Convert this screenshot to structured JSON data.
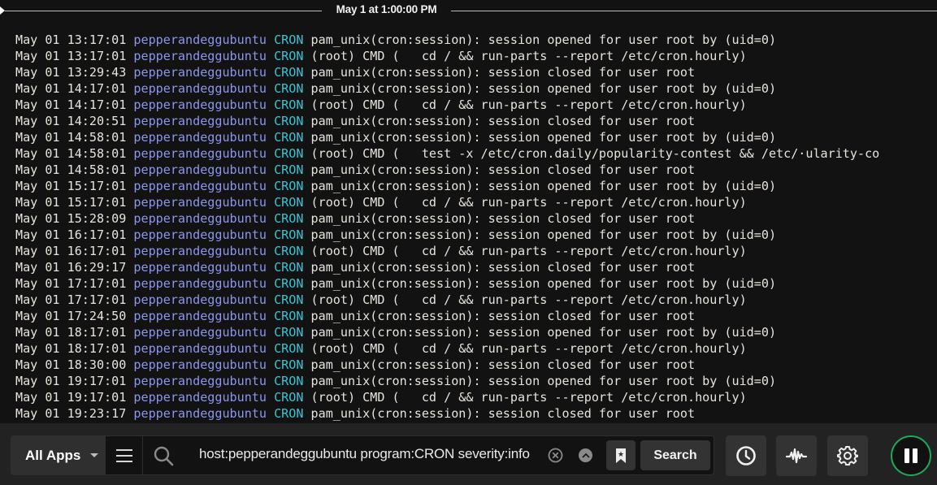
{
  "timeline": {
    "label": "May 1 at 1:00:00 PM"
  },
  "log": [
    {
      "ts": "May 01 13:17:01",
      "host": "pepperandeggubuntu",
      "program": "CRON",
      "message": "pam_unix(cron:session): session opened for user root by (uid=0)"
    },
    {
      "ts": "May 01 13:17:01",
      "host": "pepperandeggubuntu",
      "program": "CRON",
      "message": "(root) CMD (   cd / && run-parts --report /etc/cron.hourly)"
    },
    {
      "ts": "May 01 13:29:43",
      "host": "pepperandeggubuntu",
      "program": "CRON",
      "message": "pam_unix(cron:session): session closed for user root"
    },
    {
      "ts": "May 01 14:17:01",
      "host": "pepperandeggubuntu",
      "program": "CRON",
      "message": "pam_unix(cron:session): session opened for user root by (uid=0)"
    },
    {
      "ts": "May 01 14:17:01",
      "host": "pepperandeggubuntu",
      "program": "CRON",
      "message": "(root) CMD (   cd / && run-parts --report /etc/cron.hourly)"
    },
    {
      "ts": "May 01 14:20:51",
      "host": "pepperandeggubuntu",
      "program": "CRON",
      "message": "pam_unix(cron:session): session closed for user root"
    },
    {
      "ts": "May 01 14:58:01",
      "host": "pepperandeggubuntu",
      "program": "CRON",
      "message": "pam_unix(cron:session): session opened for user root by (uid=0)"
    },
    {
      "ts": "May 01 14:58:01",
      "host": "pepperandeggubuntu",
      "program": "CRON",
      "message": "(root) CMD (   test -x /etc/cron.daily/popularity-contest && /etc/·ularity-co"
    },
    {
      "ts": "May 01 14:58:01",
      "host": "pepperandeggubuntu",
      "program": "CRON",
      "message": "pam_unix(cron:session): session closed for user root"
    },
    {
      "ts": "May 01 15:17:01",
      "host": "pepperandeggubuntu",
      "program": "CRON",
      "message": "pam_unix(cron:session): session opened for user root by (uid=0)"
    },
    {
      "ts": "May 01 15:17:01",
      "host": "pepperandeggubuntu",
      "program": "CRON",
      "message": "(root) CMD (   cd / && run-parts --report /etc/cron.hourly)"
    },
    {
      "ts": "May 01 15:28:09",
      "host": "pepperandeggubuntu",
      "program": "CRON",
      "message": "pam_unix(cron:session): session closed for user root"
    },
    {
      "ts": "May 01 16:17:01",
      "host": "pepperandeggubuntu",
      "program": "CRON",
      "message": "pam_unix(cron:session): session opened for user root by (uid=0)"
    },
    {
      "ts": "May 01 16:17:01",
      "host": "pepperandeggubuntu",
      "program": "CRON",
      "message": "(root) CMD (   cd / && run-parts --report /etc/cron.hourly)"
    },
    {
      "ts": "May 01 16:29:17",
      "host": "pepperandeggubuntu",
      "program": "CRON",
      "message": "pam_unix(cron:session): session closed for user root"
    },
    {
      "ts": "May 01 17:17:01",
      "host": "pepperandeggubuntu",
      "program": "CRON",
      "message": "pam_unix(cron:session): session opened for user root by (uid=0)"
    },
    {
      "ts": "May 01 17:17:01",
      "host": "pepperandeggubuntu",
      "program": "CRON",
      "message": "(root) CMD (   cd / && run-parts --report /etc/cron.hourly)"
    },
    {
      "ts": "May 01 17:24:50",
      "host": "pepperandeggubuntu",
      "program": "CRON",
      "message": "pam_unix(cron:session): session closed for user root"
    },
    {
      "ts": "May 01 18:17:01",
      "host": "pepperandeggubuntu",
      "program": "CRON",
      "message": "pam_unix(cron:session): session opened for user root by (uid=0)"
    },
    {
      "ts": "May 01 18:17:01",
      "host": "pepperandeggubuntu",
      "program": "CRON",
      "message": "(root) CMD (   cd / && run-parts --report /etc/cron.hourly)"
    },
    {
      "ts": "May 01 18:30:00",
      "host": "pepperandeggubuntu",
      "program": "CRON",
      "message": "pam_unix(cron:session): session closed for user root"
    },
    {
      "ts": "May 01 19:17:01",
      "host": "pepperandeggubuntu",
      "program": "CRON",
      "message": "pam_unix(cron:session): session opened for user root by (uid=0)"
    },
    {
      "ts": "May 01 19:17:01",
      "host": "pepperandeggubuntu",
      "program": "CRON",
      "message": "(root) CMD (   cd / && run-parts --report /etc/cron.hourly)"
    },
    {
      "ts": "May 01 19:23:17",
      "host": "pepperandeggubuntu",
      "program": "CRON",
      "message": "pam_unix(cron:session): session closed for user root"
    }
  ],
  "toolbar": {
    "apps_label": "All Apps",
    "query": "host:pepperandeggubuntu program:CRON severity:info",
    "search_label": "Search",
    "icons": {
      "menu": "hamburger-menu-icon",
      "search": "search-icon",
      "clear": "clear-circle-x-icon",
      "collapse": "chevron-up-circle-icon",
      "bookmark": "bookmark-star-icon",
      "time": "clock-icon",
      "graph": "waveform-icon",
      "settings": "gear-icon",
      "pause": "pause-icon"
    }
  },
  "colors": {
    "host": "#8c96ec",
    "program": "#35c5d6",
    "live_ring": "#1faa59"
  }
}
